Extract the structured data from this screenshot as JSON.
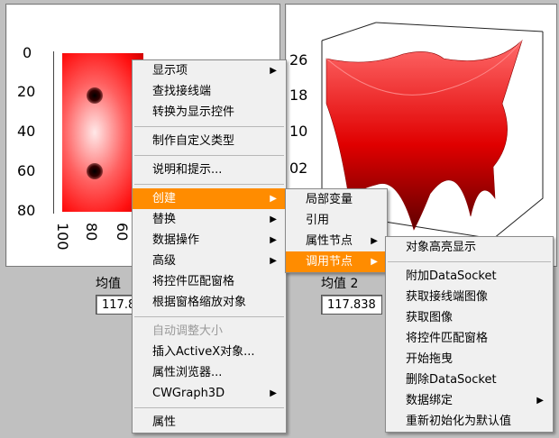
{
  "left_chart": {
    "y_ticks": [
      "0",
      "20",
      "40",
      "60",
      "80"
    ],
    "x_ticks": [
      "100",
      "80",
      "60"
    ]
  },
  "right_chart": {
    "z_ticks": [
      "26",
      "18",
      "10",
      "02"
    ]
  },
  "indicators": [
    {
      "label": "均值",
      "value": "117.8"
    },
    {
      "label": "均值 2",
      "value": "117.838"
    }
  ],
  "main_menu": {
    "items": [
      {
        "label": "显示项",
        "submenu": true
      },
      {
        "label": "查找接线端"
      },
      {
        "label": "转换为显示控件"
      },
      {
        "sep": true
      },
      {
        "label": "制作自定义类型"
      },
      {
        "sep": true
      },
      {
        "label": "说明和提示..."
      },
      {
        "sep": true
      },
      {
        "label": "创建",
        "submenu": true,
        "highlighted": true
      },
      {
        "label": "替换",
        "submenu": true
      },
      {
        "label": "数据操作",
        "submenu": true
      },
      {
        "label": "高级",
        "submenu": true
      },
      {
        "label": "将控件匹配窗格"
      },
      {
        "label": "根据窗格缩放对象"
      },
      {
        "sep": true
      },
      {
        "label": "自动调整大小",
        "disabled": true
      },
      {
        "label": "插入ActiveX对象..."
      },
      {
        "label": "属性浏览器..."
      },
      {
        "label": "CWGraph3D",
        "submenu": true
      },
      {
        "sep": true
      },
      {
        "label": "属性"
      }
    ]
  },
  "create_menu": {
    "items": [
      {
        "label": "局部变量"
      },
      {
        "label": "引用"
      },
      {
        "label": "属性节点",
        "submenu": true
      },
      {
        "label": "调用节点",
        "submenu": true,
        "highlighted": true
      }
    ]
  },
  "invoke_menu": {
    "items": [
      {
        "label": "对象高亮显示"
      },
      {
        "sep": true
      },
      {
        "label": "附加DataSocket"
      },
      {
        "label": "获取接线端图像"
      },
      {
        "label": "获取图像"
      },
      {
        "label": "将控件匹配窗格"
      },
      {
        "label": "开始拖曳"
      },
      {
        "label": "删除DataSocket"
      },
      {
        "label": "数据绑定",
        "submenu": true
      },
      {
        "label": "重新初始化为默认值"
      }
    ]
  },
  "colors": {
    "highlight": "#ff8c00",
    "surface_red": "#e00000"
  },
  "icons": {
    "submenu_arrow": "▶"
  }
}
